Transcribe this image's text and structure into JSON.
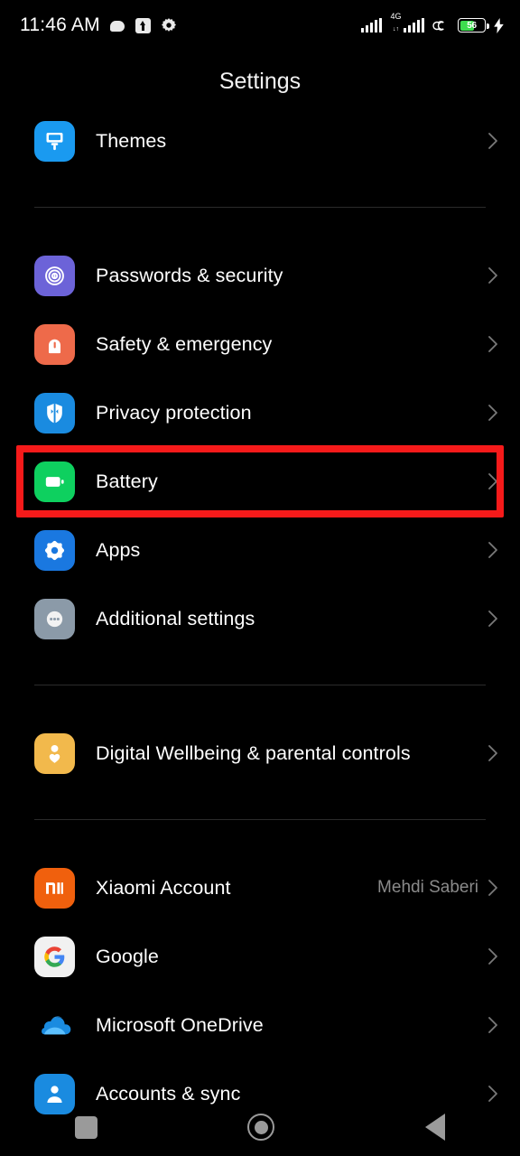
{
  "status_bar": {
    "time": "11:46 AM",
    "left_icons": [
      "cloud-blob-icon",
      "upload-icon",
      "gear-icon"
    ],
    "network_label": "4G",
    "network_sublabel": "↓↑",
    "right_icons": [
      "signal-bars-icon",
      "network-4g-icon",
      "signal-bars-icon",
      "swirl-icon",
      "battery-icon",
      "charging-bolt-icon"
    ],
    "battery_percent": "56",
    "battery_level": 56,
    "battery_color": "#3ddc4e",
    "charging": true
  },
  "header": {
    "title": "Settings"
  },
  "highlight": {
    "color": "#f61a1a",
    "target": "Battery"
  },
  "groups": [
    {
      "id": "group-themes",
      "items": [
        {
          "label": "Themes",
          "icon": "themes-icon",
          "icon_bg": "#1a9af0",
          "value": "",
          "chevron": "chevron-right-icon",
          "highlighted": false
        }
      ]
    },
    {
      "id": "group-security",
      "items": [
        {
          "label": "Passwords & security",
          "icon": "fingerprint-icon",
          "icon_bg": "#6c63d8",
          "value": "",
          "chevron": "chevron-right-icon",
          "highlighted": false
        },
        {
          "label": "Safety & emergency",
          "icon": "siren-icon",
          "icon_bg": "#ee6a4a",
          "value": "",
          "chevron": "chevron-right-icon",
          "highlighted": false
        },
        {
          "label": "Privacy protection",
          "icon": "shield-icon",
          "icon_bg": "#1a8be0",
          "value": "",
          "chevron": "chevron-right-icon",
          "highlighted": false
        },
        {
          "label": "Battery",
          "icon": "battery-settings-icon",
          "icon_bg": "#0ed05f",
          "value": "",
          "chevron": "chevron-right-icon",
          "highlighted": true
        },
        {
          "label": "Apps",
          "icon": "apps-gear-icon",
          "icon_bg": "#1a78e0",
          "value": "",
          "chevron": "chevron-right-icon",
          "highlighted": false
        },
        {
          "label": "Additional settings",
          "icon": "ellipsis-icon",
          "icon_bg": "#8b9aa8",
          "value": "",
          "chevron": "chevron-right-icon",
          "highlighted": false
        }
      ]
    },
    {
      "id": "group-wellbeing",
      "items": [
        {
          "label": "Digital Wellbeing & parental controls",
          "icon": "person-heart-icon",
          "icon_bg": "#f2b94c",
          "value": "",
          "chevron": "chevron-right-icon",
          "highlighted": false
        }
      ]
    },
    {
      "id": "group-accounts",
      "items": [
        {
          "label": "Xiaomi Account",
          "icon": "xiaomi-mi-icon",
          "icon_bg": "#f0600d",
          "value": "Mehdi Saberi",
          "chevron": "chevron-right-icon",
          "highlighted": false
        },
        {
          "label": "Google",
          "icon": "google-g-icon",
          "icon_bg": "#f1f1f1",
          "value": "",
          "chevron": "chevron-right-icon",
          "highlighted": false
        },
        {
          "label": "Microsoft OneDrive",
          "icon": "onedrive-cloud-icon",
          "icon_bg": "transparent",
          "value": "",
          "chevron": "chevron-right-icon",
          "highlighted": false
        },
        {
          "label": "Accounts & sync",
          "icon": "account-sync-icon",
          "icon_bg": "#1a8be0",
          "value": "",
          "chevron": "chevron-right-icon",
          "highlighted": false
        }
      ]
    }
  ],
  "nav_bar": {
    "recents_label": "Recents",
    "home_label": "Home",
    "back_label": "Back",
    "icons": [
      "recents-square-icon",
      "home-circle-icon",
      "back-triangle-icon"
    ]
  }
}
